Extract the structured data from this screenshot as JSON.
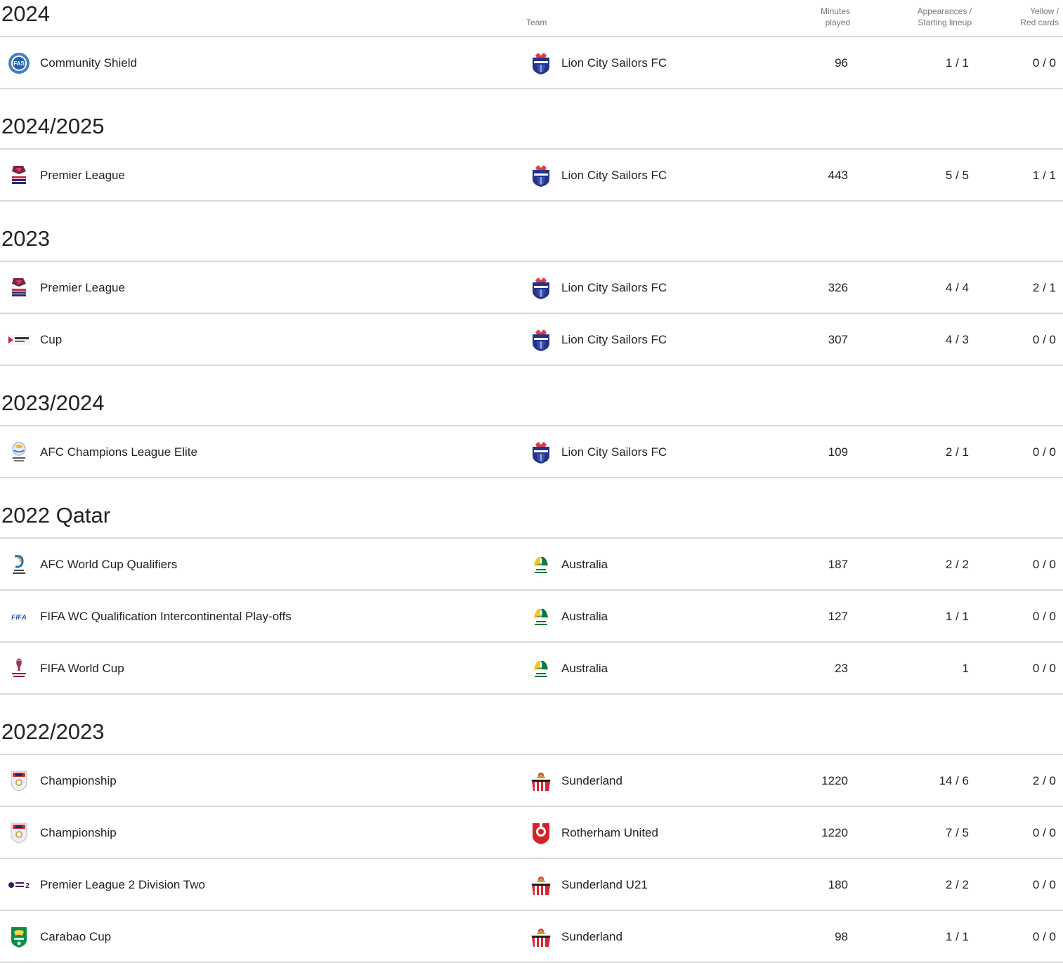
{
  "headers": {
    "team": "Team",
    "minutes_line1": "Minutes",
    "minutes_line2": "played",
    "appearances_line1": "Appearances /",
    "appearances_line2": "Starting lineup",
    "cards_line1": "Yellow /",
    "cards_line2": "Red cards"
  },
  "seasons": [
    {
      "title": "2024",
      "rows": [
        {
          "competition": "Community Shield",
          "competition_icon": "community-shield-logo",
          "team": "Lion City Sailors FC",
          "team_icon": "lion-city-sailors-crest",
          "minutes": "96",
          "appearances": "1 / 1",
          "cards": "0 / 0"
        }
      ]
    },
    {
      "title": "2024/2025",
      "rows": [
        {
          "competition": "Premier League",
          "competition_icon": "singapore-premier-league-logo",
          "team": "Lion City Sailors FC",
          "team_icon": "lion-city-sailors-crest",
          "minutes": "443",
          "appearances": "5 / 5",
          "cards": "1 / 1"
        }
      ]
    },
    {
      "title": "2023",
      "rows": [
        {
          "competition": "Premier League",
          "competition_icon": "singapore-premier-league-logo",
          "team": "Lion City Sailors FC",
          "team_icon": "lion-city-sailors-crest",
          "minutes": "326",
          "appearances": "4 / 4",
          "cards": "2 / 1"
        },
        {
          "competition": "Cup",
          "competition_icon": "singapore-cup-logo",
          "team": "Lion City Sailors FC",
          "team_icon": "lion-city-sailors-crest",
          "minutes": "307",
          "appearances": "4 / 3",
          "cards": "0 / 0"
        }
      ]
    },
    {
      "title": "2023/2024",
      "rows": [
        {
          "competition": "AFC Champions League Elite",
          "competition_icon": "afc-champions-league-logo",
          "team": "Lion City Sailors FC",
          "team_icon": "lion-city-sailors-crest",
          "minutes": "109",
          "appearances": "2 / 1",
          "cards": "0 / 0"
        }
      ]
    },
    {
      "title": "2022 Qatar",
      "rows": [
        {
          "competition": "AFC World Cup Qualifiers",
          "competition_icon": "asian-qualifiers-logo",
          "team": "Australia",
          "team_icon": "football-australia-crest",
          "minutes": "187",
          "appearances": "2 / 2",
          "cards": "0 / 0"
        },
        {
          "competition": "FIFA WC Qualification Intercontinental Play-offs",
          "competition_icon": "fifa-logo",
          "team": "Australia",
          "team_icon": "football-australia-crest",
          "minutes": "127",
          "appearances": "1 / 1",
          "cards": "0 / 0"
        },
        {
          "competition": "FIFA World Cup",
          "competition_icon": "fifa-world-cup-qatar-logo",
          "team": "Australia",
          "team_icon": "football-australia-crest",
          "minutes": "23",
          "appearances": "1",
          "cards": "0 / 0"
        }
      ]
    },
    {
      "title": "2022/2023",
      "rows": [
        {
          "competition": "Championship",
          "competition_icon": "efl-championship-logo",
          "team": "Sunderland",
          "team_icon": "sunderland-crest",
          "minutes": "1220",
          "appearances": "14 / 6",
          "cards": "2 / 0"
        },
        {
          "competition": "Championship",
          "competition_icon": "efl-championship-logo",
          "team": "Rotherham United",
          "team_icon": "rotherham-crest",
          "minutes": "1220",
          "appearances": "7 / 5",
          "cards": "0 / 0"
        },
        {
          "competition": "Premier League 2 Division Two",
          "competition_icon": "premier-league-2-logo",
          "team": "Sunderland U21",
          "team_icon": "sunderland-crest",
          "minutes": "180",
          "appearances": "2 / 2",
          "cards": "0 / 0"
        },
        {
          "competition": "Carabao Cup",
          "competition_icon": "carabao-cup-logo",
          "team": "Sunderland",
          "team_icon": "sunderland-crest",
          "minutes": "98",
          "appearances": "1 / 1",
          "cards": "0 / 0"
        }
      ]
    }
  ]
}
